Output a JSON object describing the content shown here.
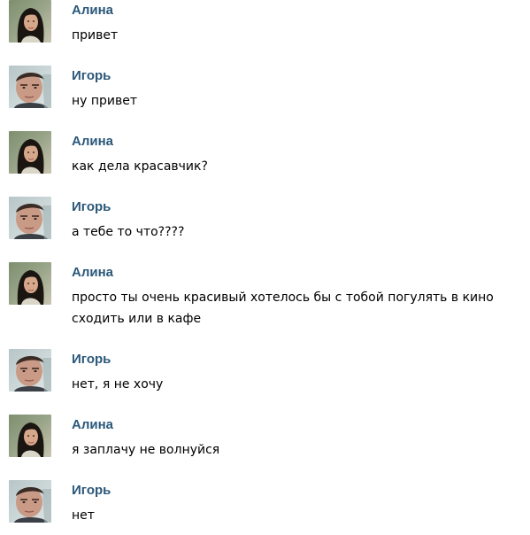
{
  "colors": {
    "name_color": "#2b587a",
    "text_color": "#000000",
    "background": "#ffffff"
  },
  "messages": [
    {
      "sender": "Алина",
      "avatar": "female-avatar",
      "text": "привет"
    },
    {
      "sender": "Игорь",
      "avatar": "male-avatar",
      "text": "ну привет"
    },
    {
      "sender": "Алина",
      "avatar": "female-avatar",
      "text": "как дела красавчик?"
    },
    {
      "sender": "Игорь",
      "avatar": "male-avatar",
      "text": "а тебе то что????"
    },
    {
      "sender": "Алина",
      "avatar": "female-avatar",
      "text": "просто ты очень красивый хотелось бы с тобой погулять в кино сходить или в кафе"
    },
    {
      "sender": "Игорь",
      "avatar": "male-avatar",
      "text": "нет, я не хочу"
    },
    {
      "sender": "Алина",
      "avatar": "female-avatar",
      "text": "я заплачу не волнуйся"
    },
    {
      "sender": "Игорь",
      "avatar": "male-avatar",
      "text": "нет"
    }
  ]
}
